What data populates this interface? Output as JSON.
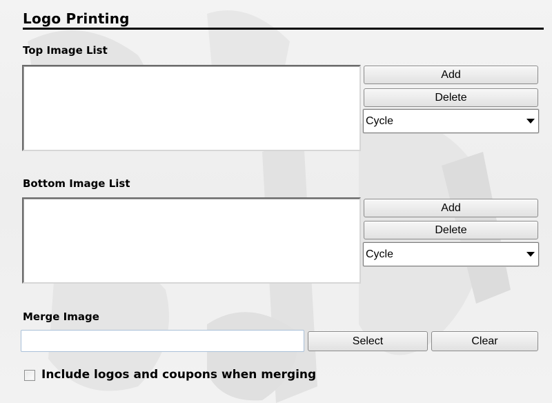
{
  "section": {
    "title": "Logo Printing"
  },
  "top_list": {
    "label": "Top Image List",
    "add_label": "Add",
    "delete_label": "Delete",
    "mode_value": "Cycle"
  },
  "bottom_list": {
    "label": "Bottom Image List",
    "add_label": "Add",
    "delete_label": "Delete",
    "mode_value": "Cycle"
  },
  "merge": {
    "label": "Merge Image",
    "path_value": "",
    "select_label": "Select",
    "clear_label": "Clear"
  },
  "include_option": {
    "label": "Include logos and coupons when merging",
    "checked": false
  }
}
